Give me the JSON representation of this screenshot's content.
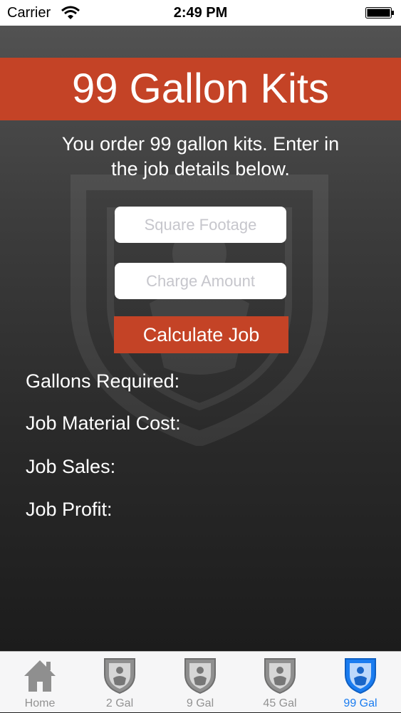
{
  "status_bar": {
    "carrier": "Carrier",
    "time": "2:49 PM"
  },
  "header": {
    "title": "99 Gallon Kits"
  },
  "instructions": {
    "line1": "You order 99 gallon kits.  Enter in",
    "line2": "the job details below."
  },
  "form": {
    "square_footage_placeholder": "Square Footage",
    "charge_amount_placeholder": "Charge Amount",
    "calculate_label": "Calculate Job"
  },
  "results": {
    "gallons_required": "Gallons Required:",
    "job_material_cost": "Job Material Cost:",
    "job_sales": "Job Sales:",
    "job_profit": "Job Profit:"
  },
  "tabs": [
    {
      "label": "Home",
      "icon": "home-icon"
    },
    {
      "label": "2 Gal",
      "icon": "shield-icon"
    },
    {
      "label": "9 Gal",
      "icon": "shield-icon"
    },
    {
      "label": "45 Gal",
      "icon": "shield-icon"
    },
    {
      "label": "99 Gal",
      "icon": "shield-icon",
      "active": true
    }
  ],
  "colors": {
    "accent": "#c44326",
    "tab_active": "#1a7cf0",
    "tab_inactive": "#929292"
  }
}
